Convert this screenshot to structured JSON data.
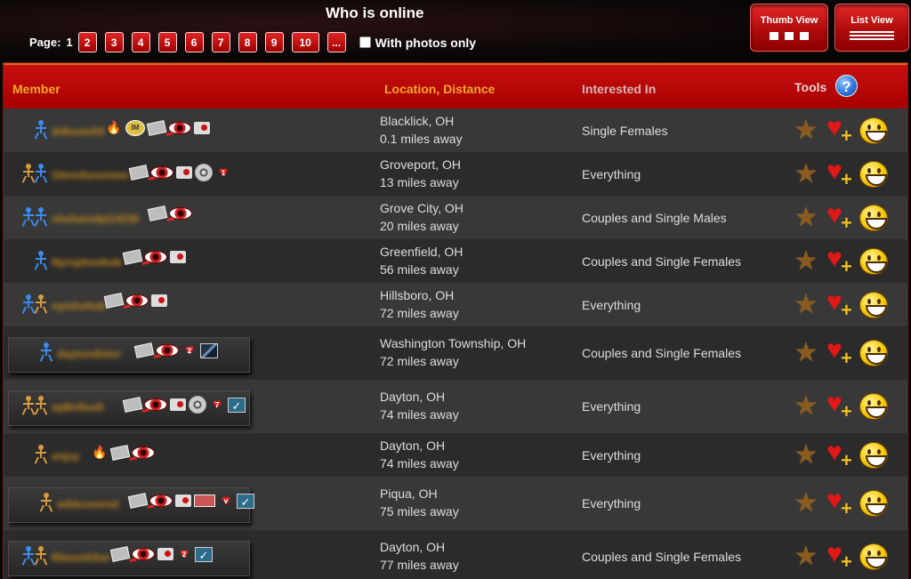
{
  "header": {
    "title": "Who is online",
    "pager": {
      "label": "Page:",
      "current": "1",
      "pages": [
        "2",
        "3",
        "4",
        "5",
        "6",
        "7",
        "8",
        "9",
        "10",
        "..."
      ]
    },
    "photos_only_label": "With photos only",
    "thumb_view_label": "Thumb View",
    "list_view_label": "List View"
  },
  "table": {
    "columns": {
      "member": "Member",
      "location": "Location, Distance",
      "interest": "Interested In",
      "tools": "Tools"
    },
    "help_icon": "?",
    "rows": [
      {
        "city": "Blacklick, OH",
        "distance": "0.1 miles away",
        "interest": "Single Females",
        "username": "3rBsomX9"
      },
      {
        "city": "Groveport, OH",
        "distance": "13 miles away",
        "interest": "Everything",
        "username": "Glensfunsmme"
      },
      {
        "city": "Grove City, OH",
        "distance": "20 miles away",
        "interest": "Couples and Single Males",
        "username": "ohsharedpi14236"
      },
      {
        "city": "Greenfield, OH",
        "distance": "56 miles away",
        "interest": "Couples and Single Females",
        "username": "Nyrophonhub"
      },
      {
        "city": "Hillsboro, OH",
        "distance": "72 miles away",
        "interest": "Everything",
        "username": "nymhohub"
      },
      {
        "city": "Washington Township, OH",
        "distance": "72 miles away",
        "interest": "Couples and Single Females",
        "username": "daytondister"
      },
      {
        "city": "Dayton, OH",
        "distance": "74 miles away",
        "interest": "Everything",
        "username": "epBrilluell"
      },
      {
        "city": "Dayton, OH",
        "distance": "74 miles away",
        "interest": "Everything",
        "username": "enjoy"
      },
      {
        "city": "Piqua, OH",
        "distance": "75 miles away",
        "interest": "Everything",
        "username": "wildcovered"
      },
      {
        "city": "Dayton, OH",
        "distance": "77 miles away",
        "interest": "Couples and Single Females",
        "username": "Rbsxmhfun"
      }
    ]
  },
  "tool_icons": [
    "star-icon",
    "favorite-heart-plus-icon",
    "smile-icon"
  ],
  "colors": {
    "accent_red": "#b80000",
    "header_orange": "#f2a825",
    "row_light": "#383838",
    "row_dark": "#2b2b2b"
  }
}
